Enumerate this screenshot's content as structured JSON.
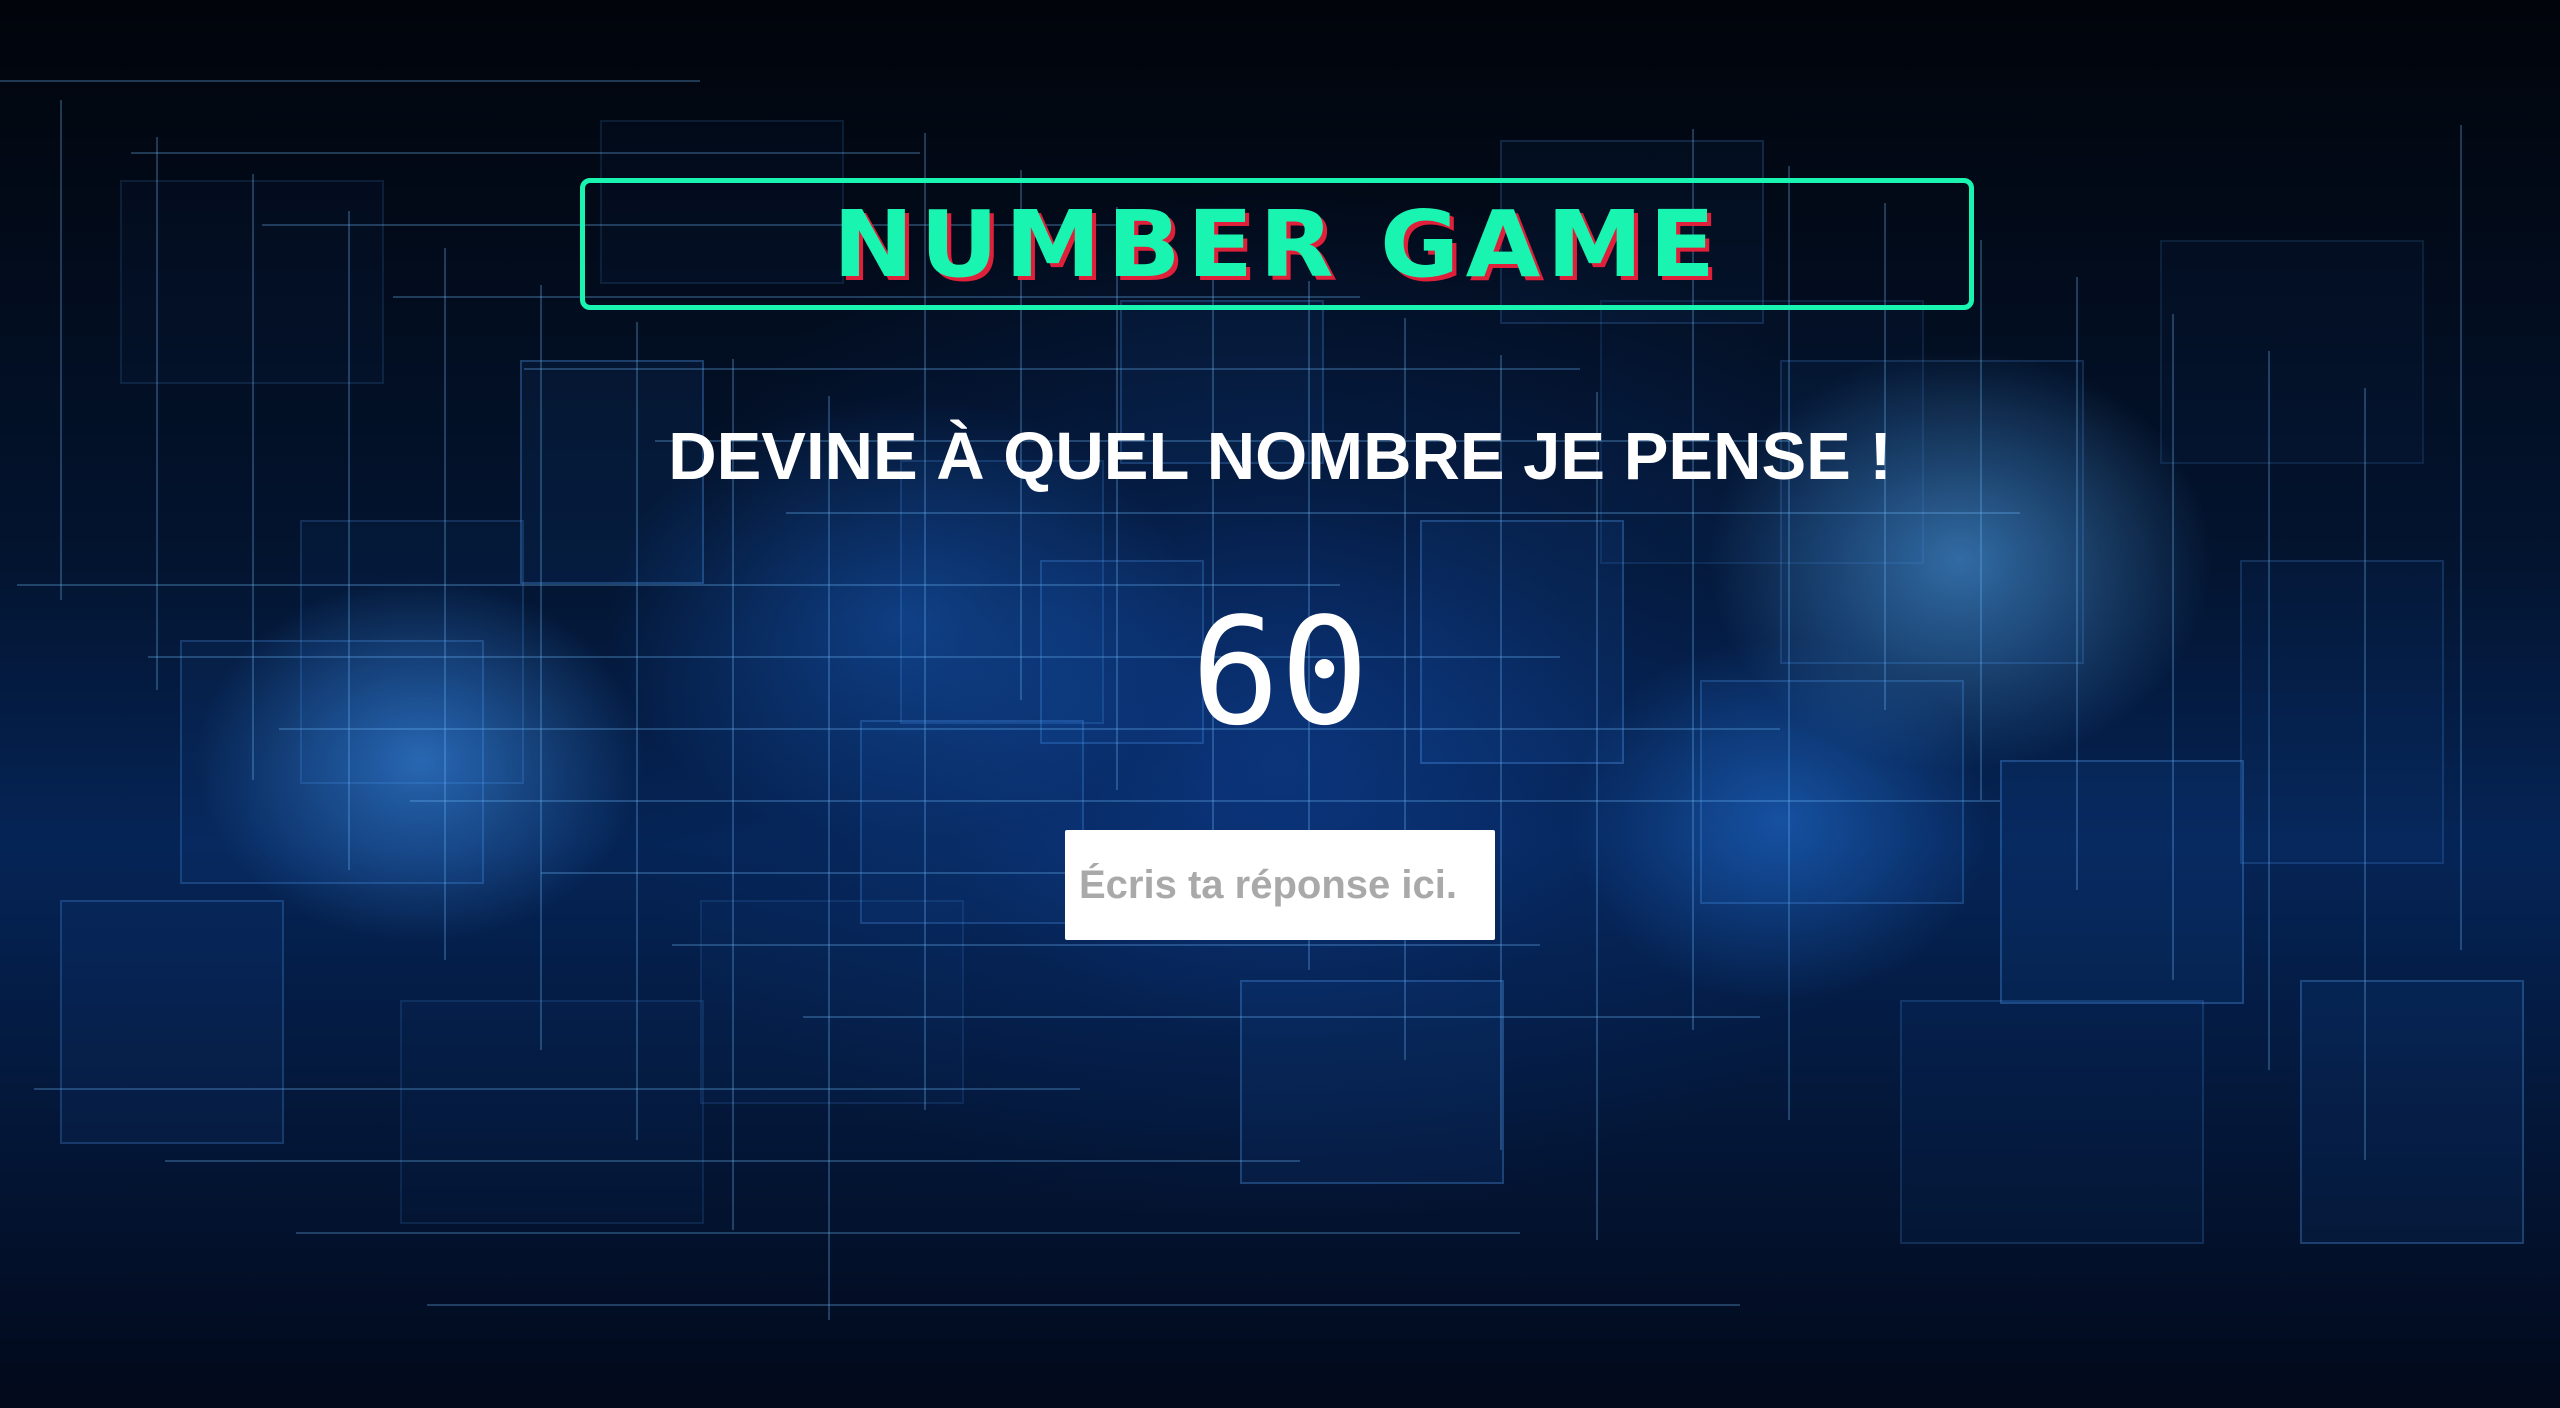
{
  "game": {
    "title": "NUMBER GAME",
    "prompt": "DEVINE À QUEL NOMBRE JE PENSE !",
    "counter": "60",
    "answer": {
      "value": "",
      "placeholder": "Écris ta réponse ici."
    }
  },
  "colors": {
    "title": "#19f5b0",
    "title_shadow": "#e0203a",
    "prompt": "#ffffff",
    "background": "#02050d"
  }
}
